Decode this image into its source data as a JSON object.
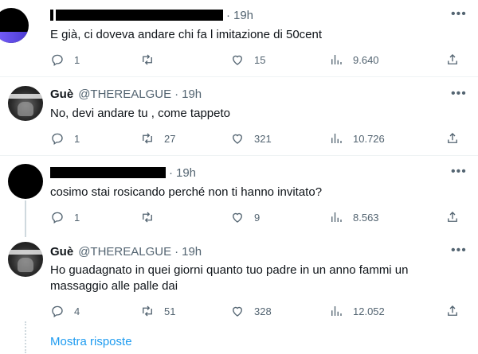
{
  "tweets": [
    {
      "author_name": "",
      "handle": "",
      "time": "19h",
      "text": "E già, ci doveva andare chi fa l imitazione di 50cent",
      "replies": "1",
      "retweets": "",
      "likes": "15",
      "views": "9.640"
    },
    {
      "author_name": "Guè",
      "handle": "@THEREALGUE",
      "time": "19h",
      "text": "No, devi andare tu , come tappeto",
      "replies": "1",
      "retweets": "27",
      "likes": "321",
      "views": "10.726"
    },
    {
      "author_name": "",
      "handle": "",
      "time": "19h",
      "text": "cosimo stai rosicando perché non ti hanno invitato?",
      "replies": "1",
      "retweets": "",
      "likes": "9",
      "views": "8.563"
    },
    {
      "author_name": "Guè",
      "handle": "@THEREALGUE",
      "time": "19h",
      "text": "Ho guadagnato in quei giorni quanto tuo padre in un anno fammi un massaggio alle palle dai",
      "replies": "4",
      "retweets": "51",
      "likes": "328",
      "views": "12.052"
    }
  ],
  "more_icon": "more-horizontal-icon",
  "show_replies_label": "Mostra risposte",
  "colors": {
    "accent": "#1d9bf0",
    "secondary_text": "#536471",
    "divider": "#eff3f4"
  }
}
